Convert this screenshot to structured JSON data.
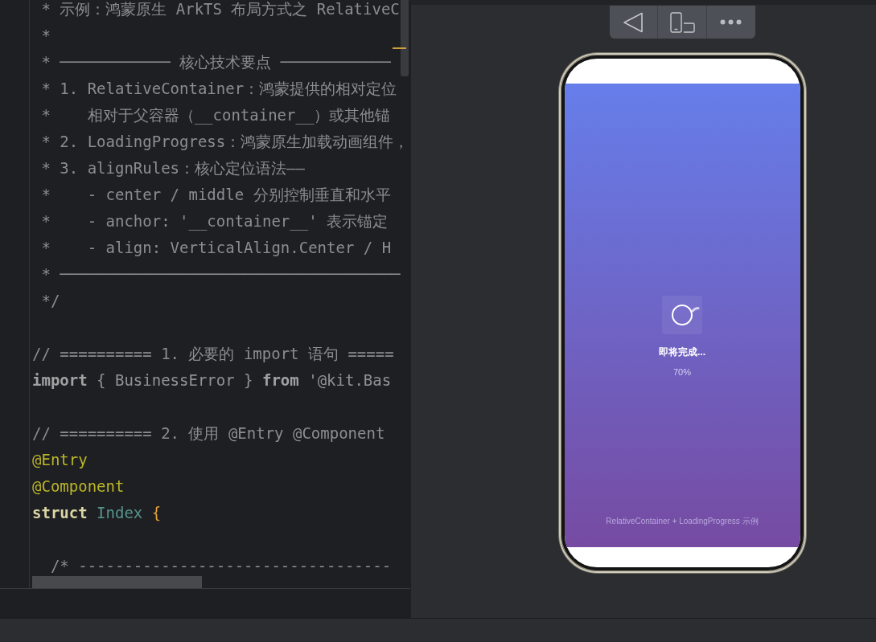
{
  "editor": {
    "code_blocks": [
      {
        "lines": [
          {
            "dimmed": false,
            "segments": [
              {
                "kind": "comment",
                "text": " * 示例：鸿蒙原生 ArkTS 布局方式之 RelativeC"
              }
            ]
          },
          {
            "dimmed": false,
            "segments": [
              {
                "kind": "comment",
                "text": " *"
              }
            ]
          },
          {
            "dimmed": false,
            "segments": [
              {
                "kind": "comment",
                "text": " * ──────────── 核心技术要点 ────────────"
              }
            ]
          },
          {
            "dimmed": false,
            "segments": [
              {
                "kind": "comment",
                "text": " * 1. RelativeContainer：鸿蒙提供的相对定位"
              }
            ]
          },
          {
            "dimmed": false,
            "segments": [
              {
                "kind": "comment",
                "text": " *    相对于父容器（__container__）或其他锚"
              }
            ]
          },
          {
            "dimmed": false,
            "segments": [
              {
                "kind": "comment",
                "text": " * 2. LoadingProgress：鸿蒙原生加载动画组件，"
              }
            ]
          },
          {
            "dimmed": false,
            "segments": [
              {
                "kind": "comment",
                "text": " * 3. alignRules：核心定位语法——"
              }
            ]
          },
          {
            "dimmed": false,
            "segments": [
              {
                "kind": "comment",
                "text": " *    - center / middle 分别控制垂直和水平"
              }
            ]
          },
          {
            "dimmed": false,
            "segments": [
              {
                "kind": "comment",
                "text": " *    - anchor: '__container__' 表示锚定"
              }
            ]
          },
          {
            "dimmed": false,
            "segments": [
              {
                "kind": "comment",
                "text": " *    - align: VerticalAlign.Center / H"
              }
            ]
          },
          {
            "dimmed": false,
            "segments": [
              {
                "kind": "comment",
                "text": " * ─────────────────────────────────────"
              }
            ]
          },
          {
            "dimmed": false,
            "segments": [
              {
                "kind": "comment",
                "text": " */"
              }
            ]
          }
        ]
      },
      {
        "lines": [
          {
            "dimmed": false,
            "segments": [
              {
                "kind": "comment",
                "text": "// ========== 1. 必要的 import 语句 ====="
              }
            ]
          },
          {
            "dimmed": true,
            "segments": [
              {
                "kind": "keyword",
                "text": "import "
              },
              {
                "kind": "plain",
                "text": "{ BusinessError } "
              },
              {
                "kind": "keyword",
                "text": "from "
              },
              {
                "kind": "plain",
                "text": "'@kit.Bas"
              }
            ]
          }
        ]
      },
      {
        "lines": [
          {
            "dimmed": false,
            "segments": [
              {
                "kind": "comment",
                "text": "// ========== 2. 使用 @Entry @Component"
              }
            ]
          },
          {
            "dimmed": false,
            "segments": [
              {
                "kind": "annotation",
                "text": "@Entry"
              }
            ]
          },
          {
            "dimmed": false,
            "segments": [
              {
                "kind": "annotation",
                "text": "@Component"
              }
            ]
          },
          {
            "dimmed": false,
            "segments": [
              {
                "kind": "keyword",
                "text": "struct "
              },
              {
                "kind": "type",
                "text": "Index "
              },
              {
                "kind": "punctuation",
                "text": "{"
              }
            ]
          }
        ]
      },
      {
        "lines": [
          {
            "dimmed": false,
            "segments": [
              {
                "kind": "comment",
                "text": "  /* ----------------------------------"
              }
            ]
          }
        ]
      }
    ]
  },
  "preview": {
    "loading_title": "即将完成...",
    "loading_percent": "70%",
    "footer_text": "RelativeContainer + LoadingProgress 示例"
  }
}
